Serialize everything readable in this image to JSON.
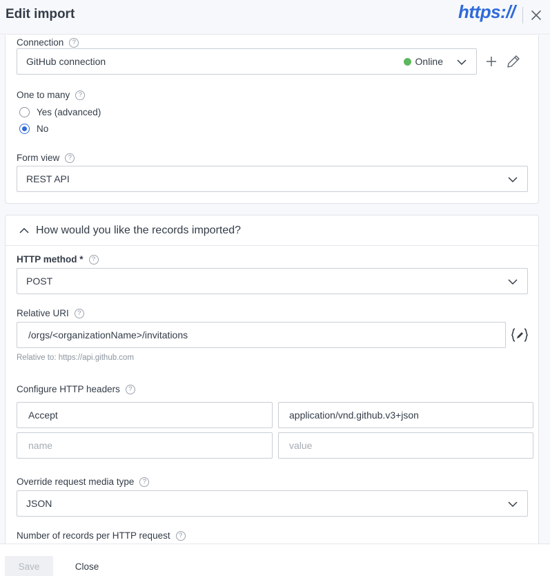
{
  "header": {
    "title": "Edit import",
    "logo_text": "https://",
    "close_icon": "close-icon"
  },
  "connection": {
    "label": "Connection",
    "value": "GitHub connection",
    "status": "Online",
    "status_color": "#5cb85c"
  },
  "one_to_many": {
    "label": "One to many",
    "options": [
      {
        "label": "Yes (advanced)",
        "checked": false
      },
      {
        "label": "No",
        "checked": true
      }
    ]
  },
  "form_view": {
    "label": "Form view",
    "value": "REST API"
  },
  "records_section": {
    "title": "How would you like the records imported?",
    "http_method": {
      "label": "HTTP method *",
      "value": "POST"
    },
    "relative_uri": {
      "label": "Relative URI",
      "value": "/orgs/<organizationName>/invitations",
      "hint": "Relative to: https://api.github.com"
    },
    "headers": {
      "label": "Configure HTTP headers",
      "rows": [
        {
          "name": "Accept",
          "value": "application/vnd.github.v3+json"
        },
        {
          "name_placeholder": "name",
          "value_placeholder": "value"
        }
      ]
    },
    "media_type": {
      "label": "Override request media type",
      "value": "JSON"
    },
    "records_per_request": {
      "label": "Number of records per HTTP request"
    }
  },
  "footer": {
    "save_label": "Save",
    "close_label": "Close"
  },
  "colors": {
    "accent": "#2f6ad9",
    "online": "#5cb85c"
  }
}
